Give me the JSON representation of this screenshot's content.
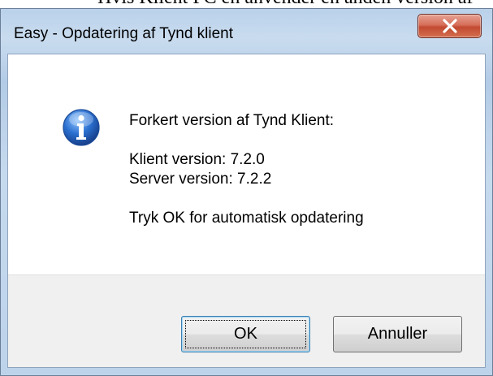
{
  "background": {
    "text": "Hvis Klient PC en anvender en anden version af"
  },
  "dialog": {
    "title": "Easy - Opdatering af Tynd klient",
    "close_glyph": "X",
    "icon": "information-icon",
    "message": {
      "line1": "Forkert version af Tynd Klient:",
      "line2": "Klient version: 7.2.0",
      "line3": "Server version: 7.2.2",
      "line4": "Tryk OK for automatisk opdatering"
    },
    "buttons": {
      "ok": "OK",
      "cancel": "Annuller"
    }
  },
  "colors": {
    "icon_blue": "#2a6fcf",
    "close_red": "#c14a31"
  }
}
